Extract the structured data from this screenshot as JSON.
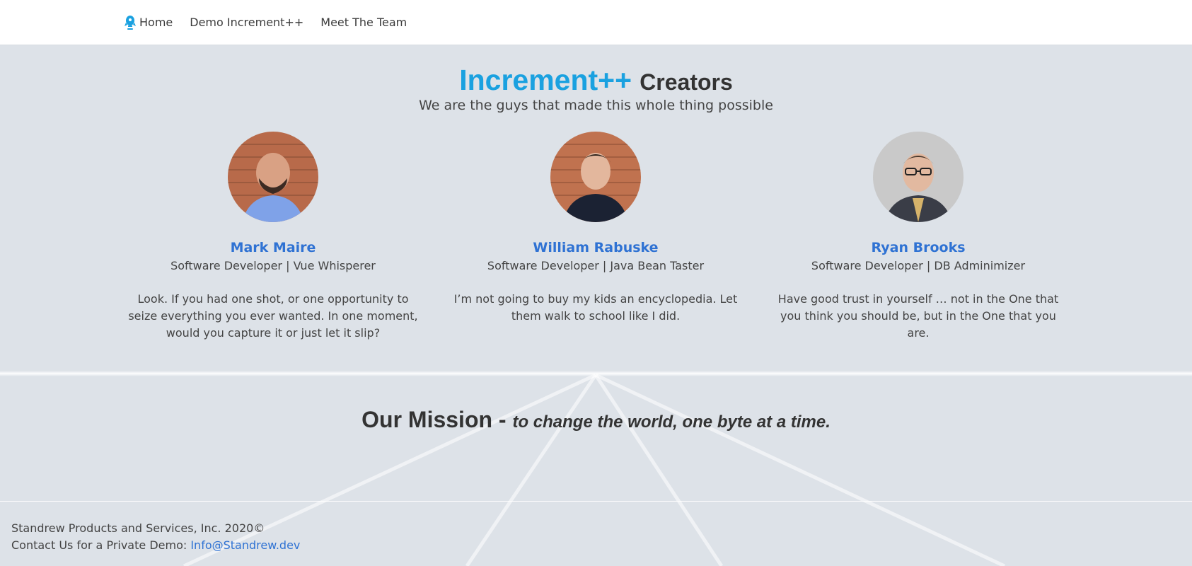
{
  "nav": {
    "logo_icon": "rocket-logo-icon",
    "items": [
      {
        "label": "Home"
      },
      {
        "label": "Demo Increment++"
      },
      {
        "label": "Meet The Team"
      }
    ]
  },
  "hero": {
    "title_accent": "Increment++",
    "title_rest": "Creators",
    "subtitle": "We are the guys that made this whole thing possible"
  },
  "team": [
    {
      "name": "Mark Maire",
      "role": "Software Developer | Vue Whisperer",
      "quote": "Look. If you had one shot, or one opportunity to seize everything you ever wanted. In one moment, would you capture it or just let it slip?"
    },
    {
      "name": "William Rabuske",
      "role": "Software Developer | Java Bean Taster",
      "quote": "I’m not going to buy my kids an encyclopedia. Let them walk to school like I did."
    },
    {
      "name": "Ryan Brooks",
      "role": "Software Developer | DB Adminimizer",
      "quote": "Have good trust in yourself … not in the One that you think you should be, but in the One that you are."
    }
  ],
  "mission": {
    "label": "Our Mission - ",
    "text": "to change the world, one byte at a time."
  },
  "footer": {
    "copyright": "Standrew Products and Services, Inc. 2020©",
    "contact_label": "Contact Us for a Private Demo: ",
    "contact_email": "Info@Standrew.dev"
  },
  "colors": {
    "accent": "#1aa1e0",
    "link": "#2f72d3",
    "background": "#dde2e8"
  }
}
